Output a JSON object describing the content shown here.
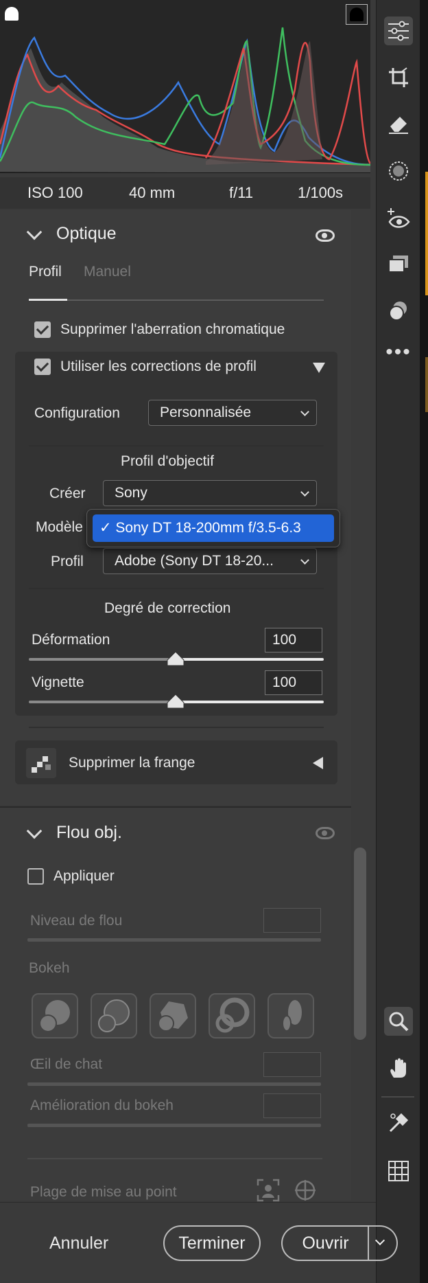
{
  "exif": {
    "iso": "ISO 100",
    "focal": "40 mm",
    "aperture": "f/11",
    "shutter": "1/100s"
  },
  "optics": {
    "title": "Optique",
    "tabs": [
      "Profil",
      "Manuel"
    ],
    "remove_ca_label": "Supprimer l'aberration chromatique",
    "use_profile_label": "Utiliser les corrections de profil",
    "configuration_label": "Configuration",
    "configuration_value": "Personnalisée",
    "lens_profile_heading": "Profil d'objectif",
    "make_label": "Créer",
    "make_value": "Sony",
    "model_label": "Modèle",
    "model_popup_value": "✓ Sony DT 18-200mm f/3.5-6.3",
    "profile_label": "Profil",
    "profile_value": "Adobe (Sony DT 18-20...",
    "correction_heading": "Degré de correction",
    "distortion_label": "Déformation",
    "distortion_value": "100",
    "distortion_level": 100,
    "vignette_label": "Vignette",
    "vignette_value": "100",
    "vignette_level": 100,
    "defringe_label": "Supprimer la frange"
  },
  "lens_blur": {
    "title": "Flou obj.",
    "apply_label": "Appliquer",
    "blur_amount_label": "Niveau de flou",
    "bokeh_label": "Bokeh",
    "cats_eye_label": "Œil de chat",
    "boost_label": "Amélioration du bokeh",
    "focal_range_label": "Plage de mise au point"
  },
  "footer": {
    "cancel": "Annuler",
    "done": "Terminer",
    "open": "Ouvrir"
  },
  "colors": {
    "accent": "#2264d6",
    "panel": "#3c3c3c",
    "toolbar": "#2e2e2e"
  }
}
